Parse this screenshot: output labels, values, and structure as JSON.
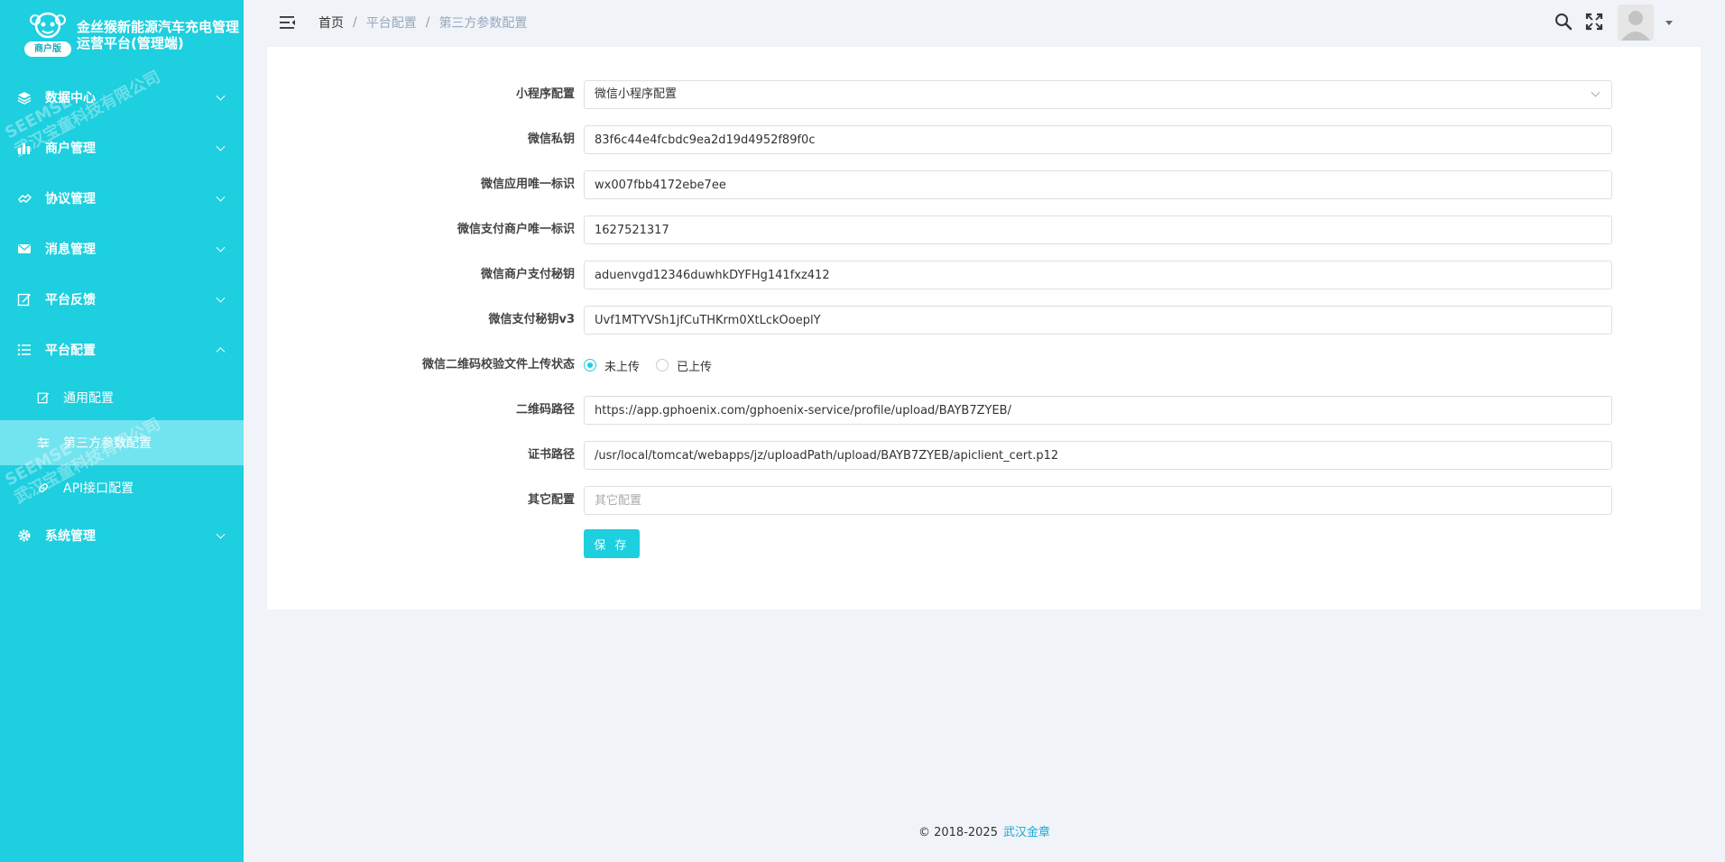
{
  "app": {
    "title": "金丝猴新能源汽车充电管理运营平台(管理端)",
    "badge": "商户版"
  },
  "sidebar": {
    "items": [
      {
        "label": "数据中心",
        "icon": "layers-icon"
      },
      {
        "label": "商户管理",
        "icon": "bar-chart-icon"
      },
      {
        "label": "协议管理",
        "icon": "handshake-icon"
      },
      {
        "label": "消息管理",
        "icon": "mail-icon"
      },
      {
        "label": "平台反馈",
        "icon": "edit-icon"
      },
      {
        "label": "平台配置",
        "icon": "list-icon",
        "expanded": true
      },
      {
        "label": "系统管理",
        "icon": "gear-icon"
      }
    ],
    "sub_items": [
      {
        "label": "通用配置",
        "icon": "edit-icon"
      },
      {
        "label": "第三方参数配置",
        "icon": "sliders-icon",
        "active": true
      },
      {
        "label": "API接口配置",
        "icon": "link-icon"
      }
    ],
    "watermark_line1": "SEEMSE",
    "watermark_line2": "武汉宝童科技有限公司"
  },
  "header": {
    "breadcrumb": [
      "首页",
      "平台配置",
      "第三方参数配置"
    ]
  },
  "form": {
    "mini_program": {
      "label": "小程序配置",
      "value": "微信小程序配置"
    },
    "wx_secret": {
      "label": "微信私钥",
      "value": "83f6c44e4fcbdc9ea2d19d4952f89f0c"
    },
    "wx_appid": {
      "label": "微信应用唯一标识",
      "value": "wx007fbb4172ebe7ee"
    },
    "wx_mchid": {
      "label": "微信支付商户唯一标识",
      "value": "1627521317"
    },
    "wx_mch_key": {
      "label": "微信商户支付秘钥",
      "value": "aduenvgd12346duwhkDYFHg141fxz412"
    },
    "wx_key_v3": {
      "label": "微信支付秘钥v3",
      "value": "Uvf1MTYVSh1jfCuTHKrm0XtLckOoeplY"
    },
    "qr_status": {
      "label": "微信二维码校验文件上传状态",
      "options": [
        "未上传",
        "已上传"
      ],
      "selected": "未上传"
    },
    "qr_path": {
      "label": "二维码路径",
      "value": "https://app.gphoenix.com/gphoenix-service/profile/upload/BAYB7ZYEB/"
    },
    "cert_path": {
      "label": "证书路径",
      "value": "/usr/local/tomcat/webapps/jz/uploadPath/upload/BAYB7ZYEB/apiclient_cert.p12"
    },
    "other": {
      "label": "其它配置",
      "value": "",
      "placeholder": "其它配置"
    },
    "save_label": "保 存"
  },
  "footer": {
    "copyright": "© 2018-2025",
    "company": "武汉金章"
  },
  "colors": {
    "accent": "#1dcfdf",
    "sidebar_active": "#72e4ef"
  }
}
